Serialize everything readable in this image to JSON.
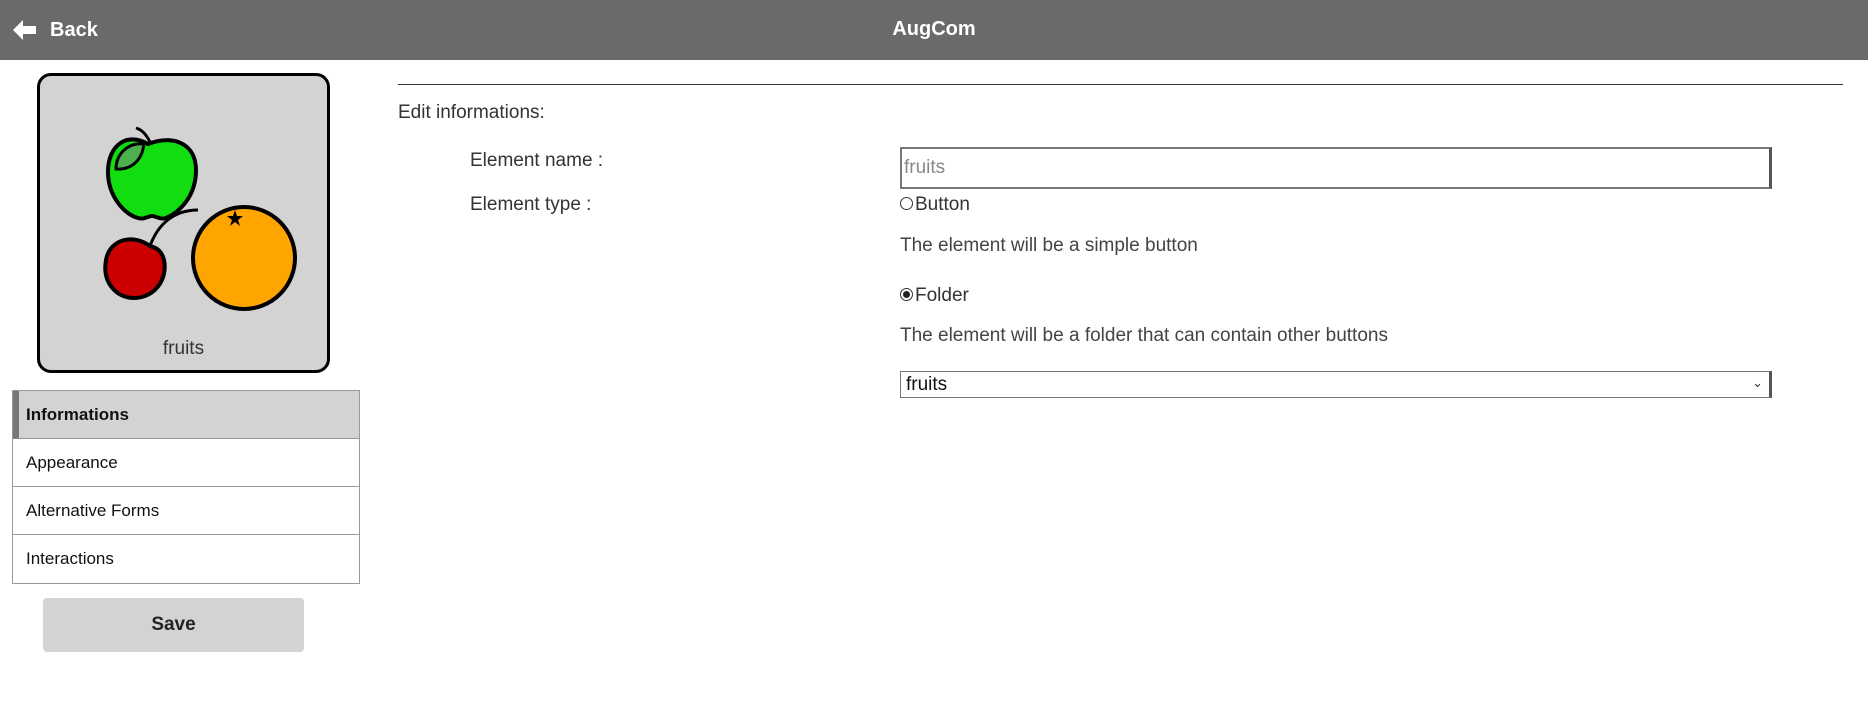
{
  "header": {
    "back_label": "Back",
    "title": "AugCom"
  },
  "preview": {
    "label": "fruits",
    "image_icon": "fruits-pictogram"
  },
  "sidebar": {
    "items": [
      {
        "label": "Informations",
        "active": true
      },
      {
        "label": "Appearance",
        "active": false
      },
      {
        "label": "Alternative Forms",
        "active": false
      },
      {
        "label": "Interactions",
        "active": false
      }
    ],
    "save_label": "Save"
  },
  "form": {
    "section_title": "Edit informations:",
    "name_label": "Element name :",
    "name_placeholder": "fruits",
    "type_label": "Element type :",
    "options": [
      {
        "label": "Button",
        "description": "The element will be a simple button",
        "checked": false
      },
      {
        "label": "Folder",
        "description": "The element will be a folder that can contain other buttons",
        "checked": true
      }
    ],
    "folder_select_value": "fruits"
  },
  "colors": {
    "header_bg": "#6a6a6a",
    "panel_gray": "#d3d3d3",
    "apple": "#11dd11",
    "cherry": "#cc0000",
    "orange": "#ffa500"
  }
}
